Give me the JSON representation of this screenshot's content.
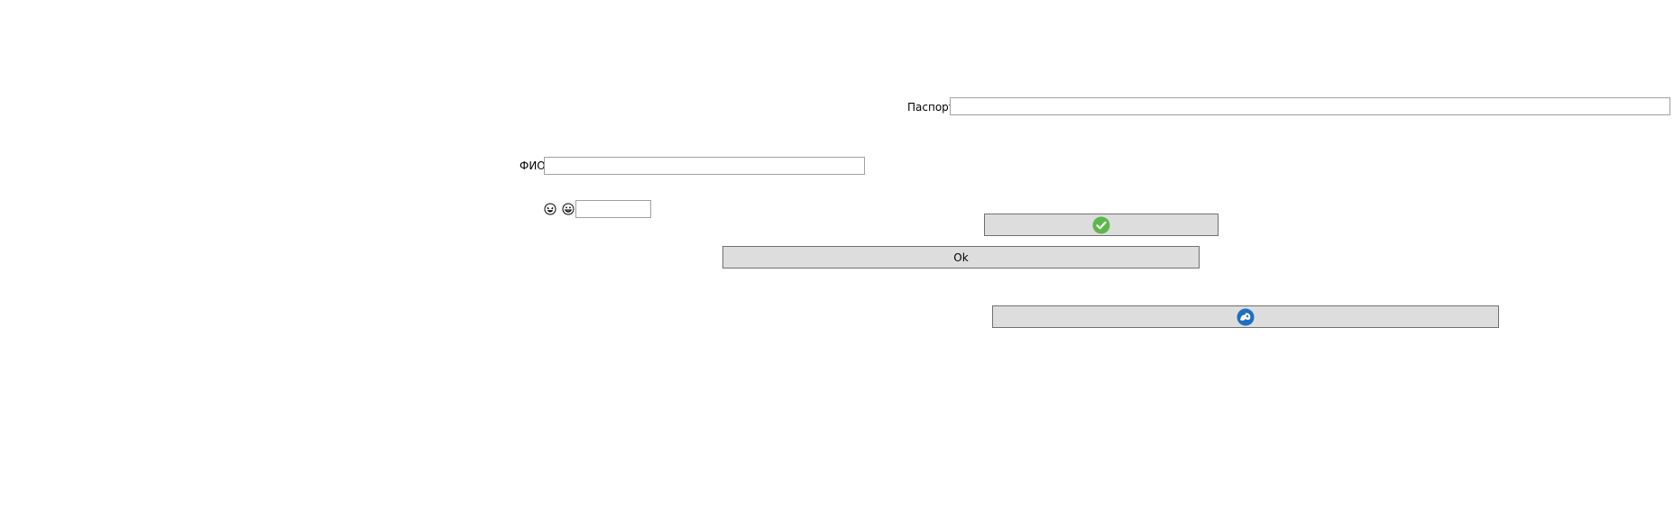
{
  "passport": {
    "label": "Паспорт",
    "value": ""
  },
  "fio": {
    "label": "ФИО",
    "value": ""
  },
  "emoji_row": {
    "icons": [
      "laughing-face-icon",
      "grinning-face-icon"
    ],
    "value": ""
  },
  "buttons": {
    "confirm_icon": "green-checkmark-icon",
    "confirm_color": "#5cb84a",
    "ok_label": "Ok",
    "third_icon": "blue-round-logo-icon",
    "third_color": "#1e6fbf"
  },
  "colors": {
    "button_face": "#dddddd",
    "button_border": "#707070",
    "field_border": "#a0a0a0"
  }
}
